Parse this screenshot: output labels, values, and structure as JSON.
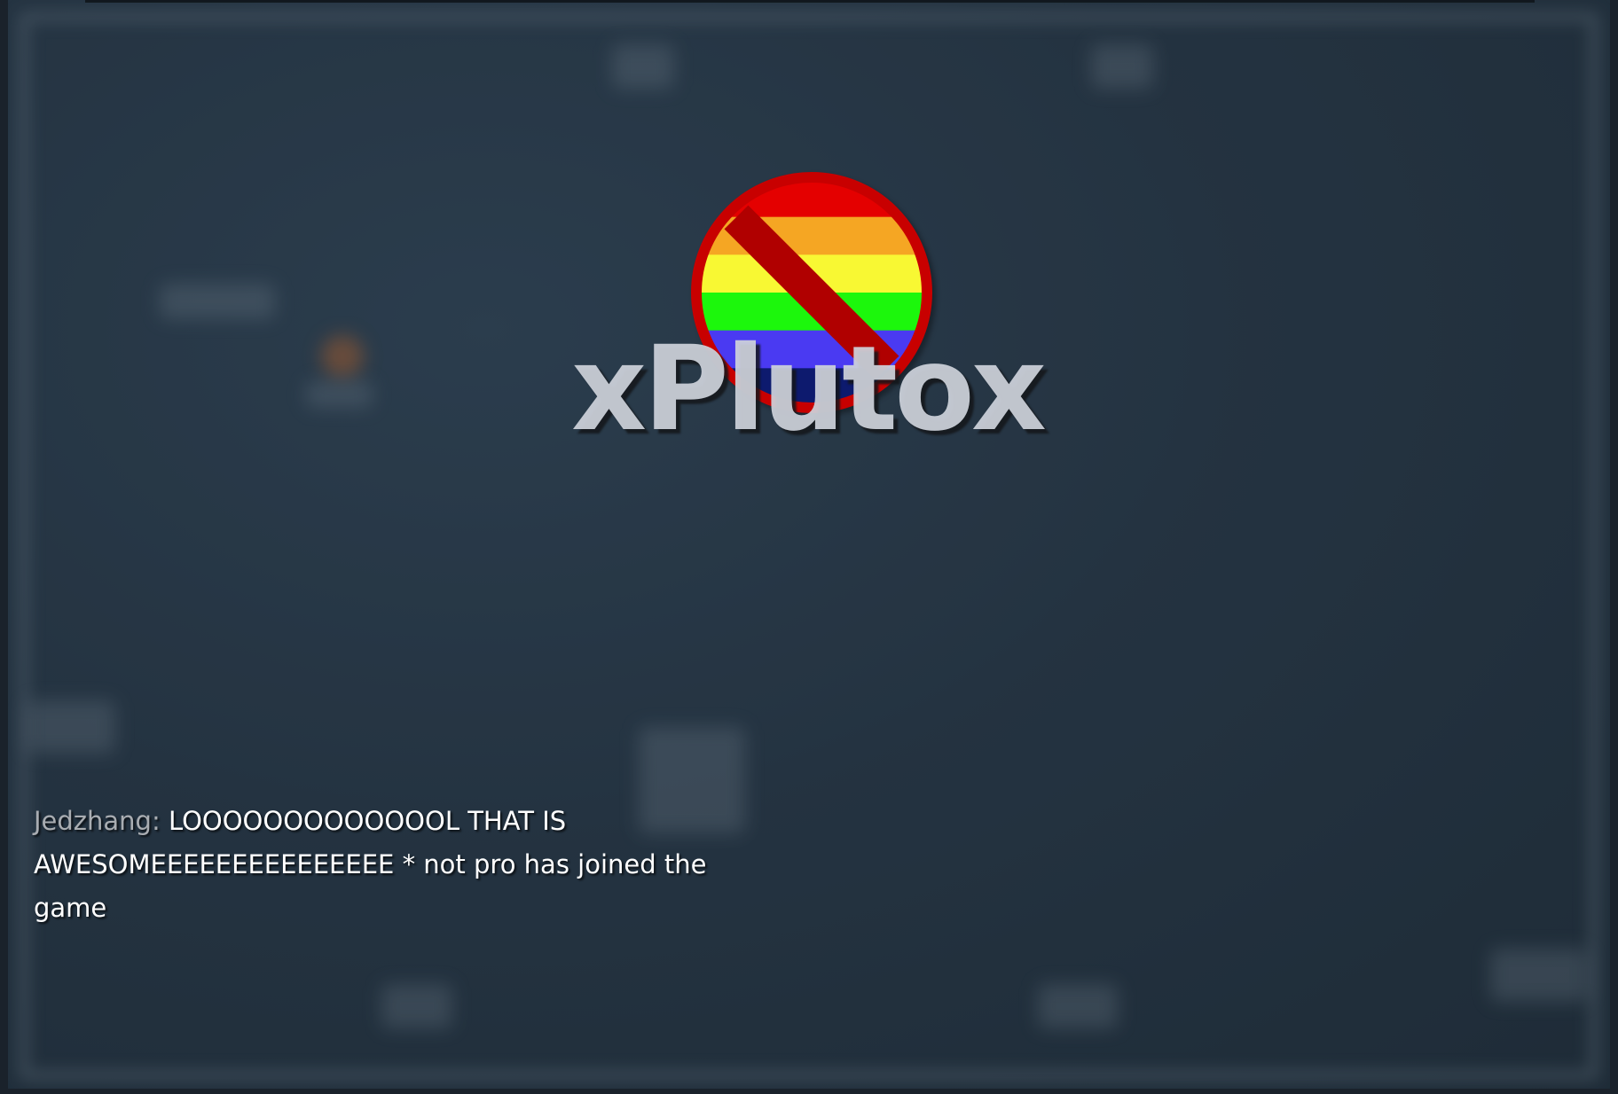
{
  "game": {
    "title": "xPlutox"
  },
  "logo": {
    "icon": "no-rainbow-icon",
    "stripe_colors": [
      "#e40000",
      "#f5a623",
      "#f8f833",
      "#1cf70c",
      "#4a3af2",
      "#0d1a6e"
    ],
    "ring_color": "#c80000",
    "slash_color": "#b00000"
  },
  "chat": {
    "messages": [
      {
        "sender": "Jedzhang:",
        "text": " LOOOOOOOOOOOOOL THAT IS AWESOMEEEEEEEEEEEEEEE"
      },
      {
        "sender": "",
        "text": " * not pro has joined the game"
      }
    ]
  }
}
